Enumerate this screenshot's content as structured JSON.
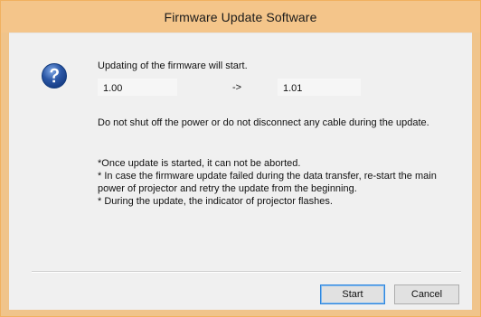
{
  "window": {
    "title": "Firmware Update Software"
  },
  "message": {
    "intro": "Updating of the firmware will start.",
    "current_version": "1.00",
    "arrow": "->",
    "new_version": "1.01",
    "warning": "Do not shut off the power or do not disconnect any cable during the update.",
    "notes": [
      "*Once update is started, it can not be aborted.",
      "* In case the firmware update failed during the data transfer, re-start the main power of projector and retry the update from the beginning.",
      "* During the update, the indicator of projector flashes."
    ]
  },
  "buttons": {
    "start": "Start",
    "cancel": "Cancel"
  },
  "icon": {
    "name": "question-icon",
    "color": "#2b57a6"
  },
  "colors": {
    "title_bar": "#f4c58a",
    "window_border": "#f1b160",
    "client_background": "#f0f0f0",
    "focus_border": "#2e86de"
  }
}
